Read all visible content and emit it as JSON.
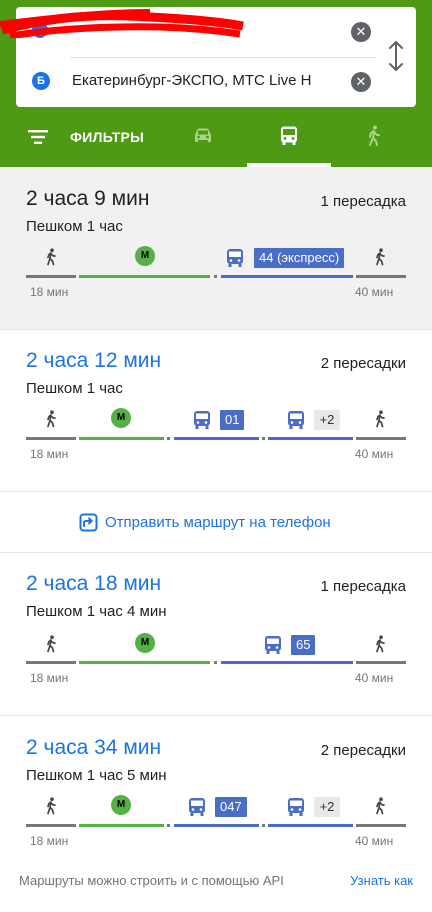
{
  "search": {
    "point_b_marker": "Б",
    "destination": "Екатеринбург-ЭКСПО, МТС Live H"
  },
  "toolbar": {
    "filters_label": "ФИЛЬТРЫ",
    "modes": [
      "car-icon",
      "bus-icon",
      "walk-icon"
    ],
    "selected_mode": "bus"
  },
  "routes": [
    {
      "time": "2 часа 9 мин",
      "transfers": "1 пересадка",
      "walk": "Пешком 1 час",
      "metro_label": "М",
      "buses": [
        "44 (экспресс)"
      ],
      "start_walk": "18 мин",
      "end_walk": "40 мин"
    },
    {
      "time": "2 часа 12 мин",
      "transfers": "2 пересадки",
      "walk": "Пешком 1 час",
      "metro_label": "М",
      "buses": [
        "01"
      ],
      "more": "+2",
      "start_walk": "18 мин",
      "end_walk": "40 мин"
    },
    {
      "time": "2 часа 18 мин",
      "transfers": "1 пересадка",
      "walk": "Пешком 1 час 4 мин",
      "metro_label": "М",
      "buses": [
        "65"
      ],
      "start_walk": "18 мин",
      "end_walk": "40 мин"
    },
    {
      "time": "2 часа 34 мин",
      "transfers": "2 пересадки",
      "walk": "Пешком 1 час 5 мин",
      "metro_label": "М",
      "buses": [
        "047"
      ],
      "more": "+2",
      "start_walk": "18 мин",
      "end_walk": "40 мин"
    }
  ],
  "send_to_phone": "Отправить маршрут на телефон",
  "footer": {
    "text": "Маршруты можно строить и с помощью API",
    "link": "Узнать как"
  },
  "colors": {
    "header": "#4f9a14",
    "metro": "#55b046",
    "bus": "#4a6ec7",
    "link": "#1a73e8"
  }
}
